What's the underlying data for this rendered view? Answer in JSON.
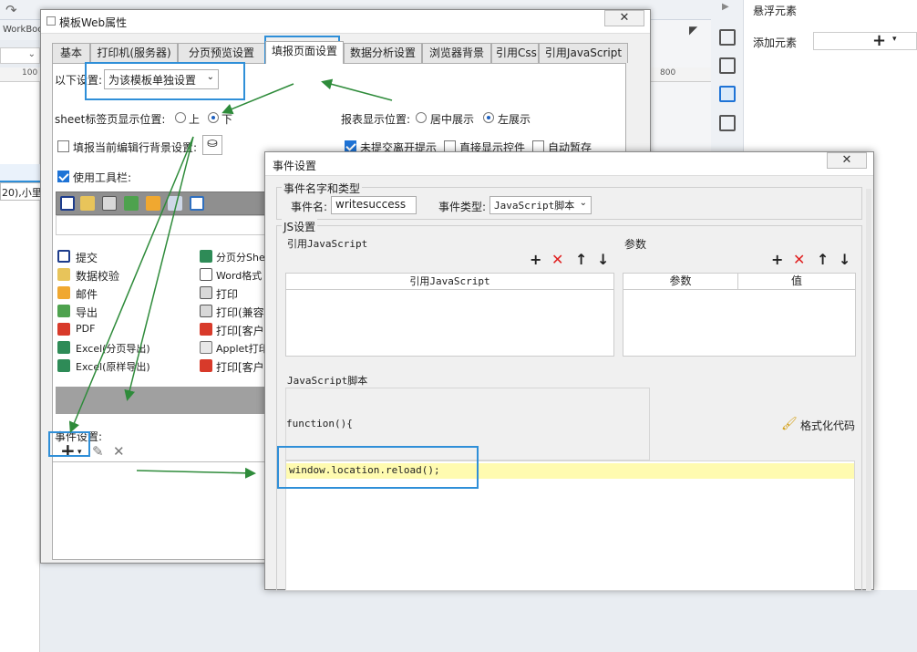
{
  "background": {
    "workbook_label": "WorkBoo",
    "ruler_100_left": "100",
    "ruler_800": "800",
    "cell_text": "20),小里",
    "floating_elements_title": "悬浮元素",
    "add_element_label": "添加元素",
    "add_element_icon": "plus-icon"
  },
  "dialog1": {
    "title": "模板Web属性",
    "tabs": [
      "基本",
      "打印机(服务器)",
      "分页预览设置",
      "填报页面设置",
      "数据分析设置",
      "浏览器背景",
      "引用Css",
      "引用JavaScript"
    ],
    "active_tab": "填报页面设置",
    "settings_label": "以下设置:",
    "settings_value": "为该模板单独设置",
    "sheet_position_label": "sheet标签页显示位置:",
    "sheet_pos_top": "上",
    "sheet_pos_bottom": "下",
    "report_position_label": "报表显示位置:",
    "report_pos_center": "居中展示",
    "report_pos_left": "左展示",
    "row_bg_label": "填报当前编辑行背景设置:",
    "unsubmitted_label": "未提交离开提示",
    "direct_show_label": "直接显示控件",
    "auto_save_label": "自动暂存",
    "toolbar_label": "使用工具栏:",
    "toolbar_items_left": [
      "提交",
      "数据校验",
      "邮件",
      "导出",
      "PDF",
      "Excel(分页导出)",
      "Excel(原样导出)"
    ],
    "toolbar_items_right": [
      "分页分She",
      "Word格式",
      "打印",
      "打印(兼容",
      "打印[客户",
      "Applet打印",
      "打印[客户"
    ],
    "event_settings_label": "事件设置:"
  },
  "dialog2": {
    "title": "事件设置",
    "group_name_type": "事件名字和类型",
    "event_name_label": "事件名:",
    "event_name_value": "writesuccess",
    "event_type_label": "事件类型:",
    "event_type_value": "JavaScript脚本",
    "group_js": "JS设置",
    "ref_js_label": "引用JavaScript",
    "ref_js_header": "引用JavaScript",
    "params_label": "参数",
    "params_header_param": "参数",
    "params_header_value": "值",
    "js_script_label": "JavaScript脚本",
    "function_header": "function(){",
    "format_code_label": "格式化代码",
    "code_line": "window.location.reload();"
  }
}
